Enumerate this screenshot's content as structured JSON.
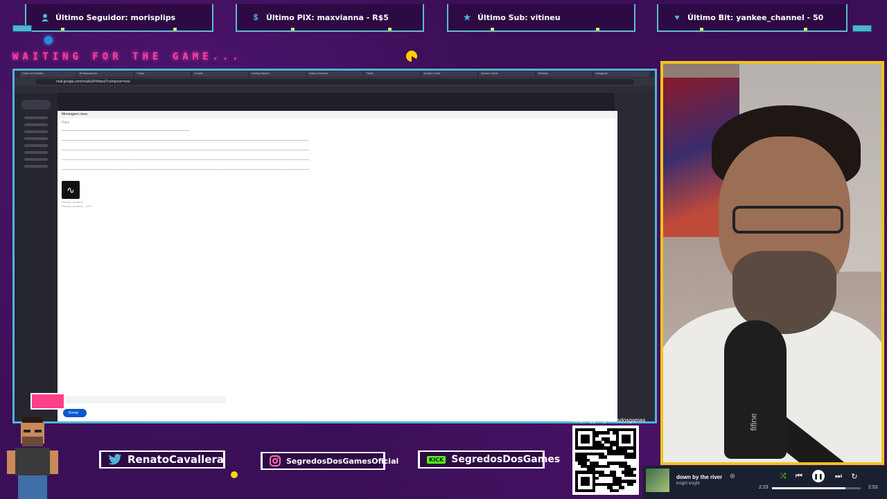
{
  "alerts": [
    {
      "icon": "user-icon",
      "text": "Último Seguidor: morisplips"
    },
    {
      "icon": "dollar-icon",
      "text": "Último PIX: maxvianna - R$5"
    },
    {
      "icon": "star-icon",
      "text": "Último Sub: vitineu"
    },
    {
      "icon": "heart-icon",
      "text": "Último Bit: yankee_channel - 50"
    }
  ],
  "waiting_text": "WAITING FOR THE GAME...",
  "browser": {
    "tabs": [
      "Caixa de entrada",
      "Embaixadores",
      "Todos",
      "Contas",
      "Configurações",
      "Game Demand",
      "Tiktok",
      "Quadro Geral",
      "Quadro Geral",
      "Noticias",
      "Instagram"
    ],
    "url": "mail.google.com/mail/u/0/#inbox?compose=new"
  },
  "compose": {
    "title": "Mensagem nova",
    "to_placeholder": "Para",
    "signature_name": "Renato Cavallera",
    "signature_role": "Renato Cavallera - CEO",
    "send_label": "Enviar"
  },
  "socials": [
    {
      "icon": "twitter-icon",
      "handle": "RenatoCavallera"
    },
    {
      "icon": "instagram-icon",
      "handle": "SegredosDosGamesOficial"
    },
    {
      "icon": "kick-icon",
      "badge": "KICK",
      "handle": "SegredosDosGames"
    }
  ],
  "qr_url": "livepix.gg/segredosdosgames",
  "player": {
    "song": "down by the river",
    "artist": "knight knight",
    "elapsed": "2:23",
    "duration": "2:53",
    "progress": 0.83
  },
  "cam_brand": "fifine",
  "colors": {
    "accent": "#4fb4d6",
    "frame": "#f0c419",
    "pink": "#ff3fa6",
    "bg": "#3b0f57"
  }
}
